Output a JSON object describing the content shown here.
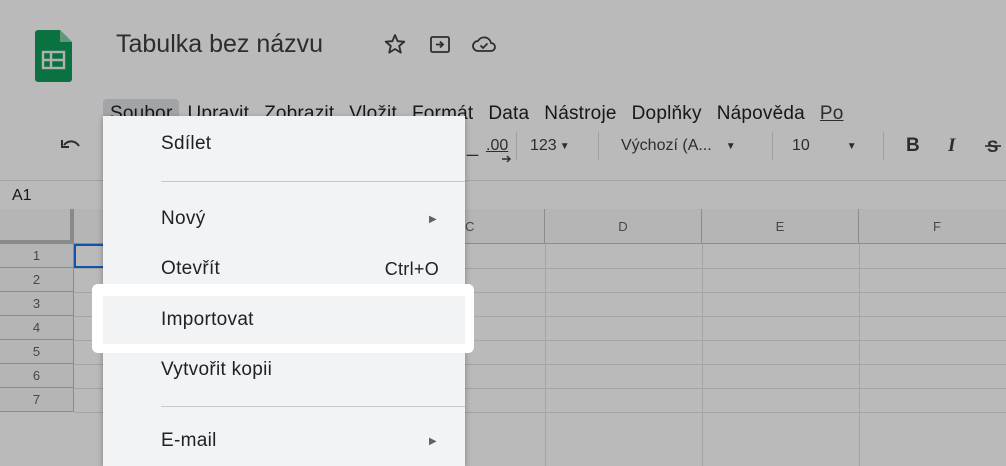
{
  "header": {
    "title": "Tabulka bez názvu"
  },
  "menubar": {
    "items": [
      "Soubor",
      "Upravit",
      "Zobrazit",
      "Vložit",
      "Formát",
      "Data",
      "Nástroje",
      "Doplňky",
      "Nápověda"
    ],
    "more_label": "Po"
  },
  "toolbar": {
    "decimal_label": ".00",
    "number_format_label": "123",
    "font_label": "Výchozí (A...",
    "font_size_label": "10",
    "bold_label": "B",
    "italic_label": "I"
  },
  "formula_bar": {
    "cell_ref": "A1"
  },
  "grid": {
    "columns": [
      "C",
      "D",
      "E",
      "F"
    ],
    "rows": [
      "1",
      "2",
      "3",
      "4",
      "5",
      "6",
      "7"
    ]
  },
  "file_menu": {
    "share_label": "Sdílet",
    "new_label": "Nový",
    "open_label": "Otevřít",
    "open_shortcut": "Ctrl+O",
    "import_label": "Importovat",
    "copy_label": "Vytvořit kopii",
    "email_label": "E-mail"
  },
  "colors": {
    "sheets_green": "#0f9d58",
    "selection_blue": "#1a73e8",
    "menu_background": "#f2f3f4"
  }
}
